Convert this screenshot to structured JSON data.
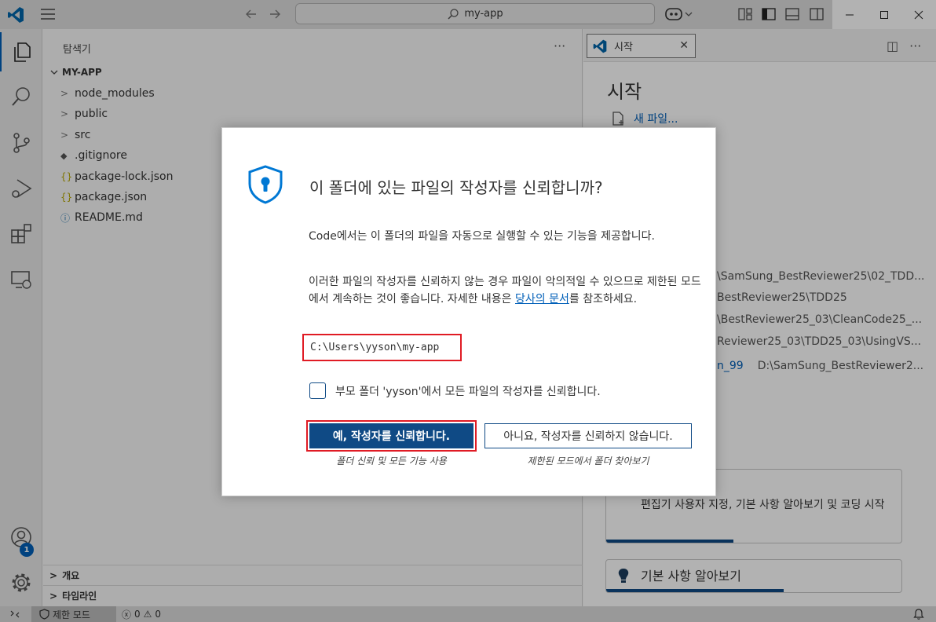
{
  "titlebar": {
    "search_text": "my-app",
    "icons": [
      "vscode-logo",
      "menu-icon",
      "back-arrow-icon",
      "forward-arrow-icon",
      "copilot-icon",
      "layout-icons"
    ],
    "window_controls": [
      "minimize",
      "maximize",
      "close"
    ]
  },
  "activity_bar": {
    "items": [
      "explorer",
      "search",
      "source-control",
      "run-debug",
      "extensions",
      "remote-explorer"
    ],
    "accounts_badge": "1"
  },
  "sidebar": {
    "title": "탐색기",
    "more": "···",
    "root": "MY-APP",
    "items": [
      {
        "label": "node_modules",
        "kind": "folder"
      },
      {
        "label": "public",
        "kind": "folder"
      },
      {
        "label": "src",
        "kind": "folder"
      },
      {
        "label": ".gitignore",
        "kind": "git"
      },
      {
        "label": "package-lock.json",
        "kind": "json"
      },
      {
        "label": "package.json",
        "kind": "json"
      },
      {
        "label": "README.md",
        "kind": "info"
      }
    ],
    "outline_label": "개요",
    "timeline_label": "타임라인"
  },
  "editor": {
    "tab_label": "시작",
    "welcome_title": "시작",
    "new_file_label": "새 파일...",
    "recent": [
      {
        "name": "",
        "path": "\\SamSung_BestReviewer25\\02_TDD..."
      },
      {
        "name": "",
        "path": "BestReviewer25\\TDD25"
      },
      {
        "name": "",
        "path": "\\BestReviewer25_03\\CleanCode25_..."
      },
      {
        "name": "",
        "path": "Reviewer25_03\\TDD25_03\\UsingVS..."
      },
      {
        "name": "n_99",
        "path": "D:\\SamSung_BestReviewer2..."
      }
    ],
    "walkthrough_desc": "편집기 사용자 지정, 기본 사항 알아보기 및 코딩 시작",
    "walkthrough_fundamentals": "기본 사항 알아보기",
    "accent": "#005fb8"
  },
  "dialog": {
    "title": "이 폴더에 있는 파일의 작성자를 신뢰합니까?",
    "para1": "Code에서는 이 폴더의 파일을 자동으로 실행할 수 있는 기능을 제공합니다.",
    "para2_text": "이러한 파일의 작성자를 신뢰하지 않는 경우 파일이 악의적일 수 있으므로 제한된 모드에서 계속하는 것이 좋습니다. 자세한 내용은 ",
    "para2_link": "당사의 문서",
    "para2_suffix": "를 참조하세요.",
    "path": "C:\\Users\\yyson\\my-app",
    "checkbox_label": "부모 폴더 'yyson'에서 모든 파일의 작성자를 신뢰합니다.",
    "checkbox_checked": false,
    "yes_button": "예, 작성자를 신뢰합니다.",
    "yes_sub": "폴더 신뢰 및 모든 기능 사용",
    "no_button": "아니요, 작성자를 신뢰하지 않습니다.",
    "no_sub": "제한된 모드에서 폴더 찾아보기",
    "button_color": "#0f4a85",
    "highlight_color": "#e01b24"
  },
  "statusbar": {
    "restricted_mode": "제한 모드",
    "errors": "0",
    "warnings": "0"
  }
}
